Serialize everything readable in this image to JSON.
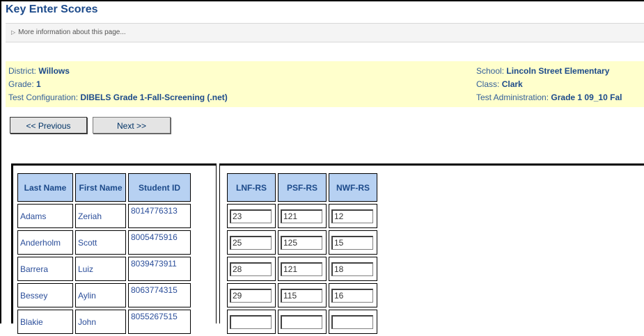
{
  "page": {
    "title": "Key Enter Scores",
    "more_info": "More information about this page..."
  },
  "info": {
    "district_label": "District: ",
    "district": "Willows",
    "grade_label": "Grade: ",
    "grade": "1",
    "test_config_label": "Test Configuration: ",
    "test_config": "DIBELS Grade 1-Fall-Screening (.net)",
    "school_label": "School: ",
    "school": "Lincoln Street Elementary",
    "class_label": "Class: ",
    "class": "Clark",
    "test_admin_label": "Test Administration: ",
    "test_admin": "Grade 1 09_10 Fal"
  },
  "nav": {
    "previous_label": "<< Previous",
    "next_label": "Next >>"
  },
  "student_table": {
    "headers": [
      "Last Name",
      "First Name",
      "Student ID"
    ],
    "rows": [
      {
        "last": "Adams",
        "first": "Zeriah",
        "id": "8014776313"
      },
      {
        "last": "Anderholm",
        "first": "Scott",
        "id": "8005475916"
      },
      {
        "last": "Barrera",
        "first": "Luiz",
        "id": "8039473911"
      },
      {
        "last": "Bessey",
        "first": "Aylin",
        "id": "8063774315"
      },
      {
        "last": "Blakie",
        "first": "John",
        "id": "8055267515"
      }
    ]
  },
  "score_table": {
    "headers": [
      "LNF-RS",
      "PSF-RS",
      "NWF-RS"
    ],
    "rows": [
      [
        "23",
        "121",
        "12"
      ],
      [
        "25",
        "125",
        "15"
      ],
      [
        "28",
        "121",
        "18"
      ],
      [
        "29",
        "115",
        "16"
      ],
      [
        "",
        "",
        ""
      ]
    ]
  }
}
